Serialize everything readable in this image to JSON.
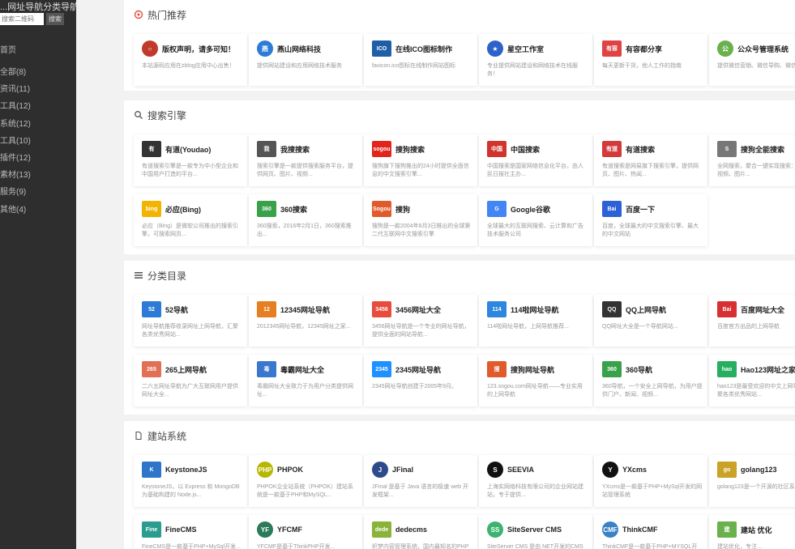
{
  "sidebar": {
    "title": "...网址导航分类导航",
    "search_placeholder": "搜索二维码",
    "search_button": "搜索",
    "home": "首页",
    "items": [
      "全部(8)",
      "资讯(11)",
      "工具(12)",
      "系统(12)",
      "工具(10)",
      "插件(12)",
      "素材(13)",
      "服务(9)",
      "其他(4)"
    ]
  },
  "sections": [
    {
      "title": "热门推荐",
      "icon": "fire-icon",
      "cards": [
        {
          "name": "版权声明，请多可知！",
          "desc": "本站源码应用在zblog应用中心出售！",
          "logo": "○",
          "color": "#c0392b",
          "wide": false
        },
        {
          "name": "燕山网络科技",
          "desc": "提供网站建设和应用网络技术服务",
          "logo": "燕",
          "color": "#2c7bd6",
          "wide": false
        },
        {
          "name": "在线ICO图标制作",
          "desc": "favicon.ico图标在线制作网站图标",
          "logo": "ICO",
          "color": "#1f5fa8",
          "wide": true
        },
        {
          "name": "星空工作室",
          "desc": "专业提供网站建设和网络技术在线服务！",
          "logo": "★",
          "color": "#2d63c8",
          "wide": false
        },
        {
          "name": "有容都分享",
          "desc": "每天更新干货，他人工作的指南",
          "logo": "有容",
          "color": "#e04343",
          "wide": true
        },
        {
          "name": "公众号管理系统",
          "desc": "提供微信营销、微信导购、微信...",
          "logo": "公",
          "color": "#6ab04c",
          "wide": false
        }
      ]
    },
    {
      "title": "搜索引擎",
      "icon": "search-icon",
      "cards": [
        {
          "name": "有道(Youdao)",
          "desc": "有道搜索引擎是一款专为中小型企业和中国用户打造的平台...",
          "logo": "有",
          "color": "#333333",
          "wide": true
        },
        {
          "name": "我搜搜索",
          "desc": "搜索引擎是一款提供搜索服务平台，提供网页、图片、视频...",
          "logo": "我",
          "color": "#555555",
          "wide": true
        },
        {
          "name": "搜狗搜索",
          "desc": "搜狗旗下搜狗推出的24小时提供全面信息的中文搜索引擎...",
          "logo": "sogou",
          "color": "#e1251b",
          "wide": true
        },
        {
          "name": "中国搜索",
          "desc": "中国搜索是国家网络信息化平台，由人民日报社主办...",
          "logo": "中国",
          "color": "#d0342c",
          "wide": true
        },
        {
          "name": "有道搜索",
          "desc": "有道搜索是网易旗下搜索引擎，提供网页、图片、热闻...",
          "logo": "有道",
          "color": "#d33a3a",
          "wide": true
        },
        {
          "name": "搜狗全能搜索",
          "desc": "全网搜索，聚合一键实现搜索：新闻、视频、图片...",
          "logo": "S",
          "color": "#777777",
          "wide": true
        },
        {
          "name": "必应(Bing)",
          "desc": "必应（Bing）是微软公司推出的搜索引擎，可搜索网页...",
          "logo": "bing",
          "color": "#f2b400",
          "wide": true
        },
        {
          "name": "360搜索",
          "desc": "360搜索，2016年2月1日，360搜索推出...",
          "logo": "360",
          "color": "#3aa14b",
          "wide": true
        },
        {
          "name": "搜狗",
          "desc": "搜狗是一款2004年8月3日推出的全球第二代互联网中文搜索引擎",
          "logo": "Sogou",
          "color": "#e05a2b",
          "wide": true
        },
        {
          "name": "Google谷歌",
          "desc": "全球最大的互联网搜索、云计算和广告技术服务公司",
          "logo": "G",
          "color": "#4285f4",
          "wide": true
        },
        {
          "name": "百度一下",
          "desc": "百度，全球最大的中文搜索引擎、最大的中文网站",
          "logo": "Bai",
          "color": "#2d62d6",
          "wide": true
        }
      ]
    },
    {
      "title": "分类目录",
      "icon": "list-icon",
      "cards": [
        {
          "name": "52导航",
          "desc": "网址导航推荐收录网址上网导航，汇聚各类优秀网站...",
          "logo": "52",
          "color": "#2d7bd6",
          "wide": true
        },
        {
          "name": "12345网址导航",
          "desc": "2012345网址导航，12345网址之家...",
          "logo": "12",
          "color": "#e67e22",
          "wide": true
        },
        {
          "name": "3456网址大全",
          "desc": "3456网址导航是一个专业的网址导航，提供全面的网站导航...",
          "logo": "3456",
          "color": "#e74c3c",
          "wide": true
        },
        {
          "name": "114啦网址导航",
          "desc": "114啦网址导航，上网导航推荐...",
          "logo": "114",
          "color": "#2e86de",
          "wide": true
        },
        {
          "name": "QQ上网导航",
          "desc": "QQ网址大全是一个导航网站...",
          "logo": "QQ",
          "color": "#333333",
          "wide": true
        },
        {
          "name": "百度网址大全",
          "desc": "百度官方出品的上网导航",
          "logo": "Bai",
          "color": "#d63031",
          "wide": true
        },
        {
          "name": "265上网导航",
          "desc": "二六五网址导航为广大互联网用户提供网址大全...",
          "logo": "265",
          "color": "#e17055",
          "wide": true
        },
        {
          "name": "毒霸网址大全",
          "desc": "毒霸网址大全致力于为用户分类提供网址...",
          "logo": "毒",
          "color": "#3a78d0",
          "wide": true
        },
        {
          "name": "2345网址导航",
          "desc": "2345网址导航创建于2005年9月。",
          "logo": "2345",
          "color": "#1e90ff",
          "wide": true
        },
        {
          "name": "搜狗网址导航",
          "desc": "123.sogou.com网址导航——专业实用的上网导航",
          "logo": "搜",
          "color": "#e05a2b",
          "wide": true
        },
        {
          "name": "360导航",
          "desc": "360导航，一个安全上网导航，为用户提供门户、新闻、视频...",
          "logo": "360",
          "color": "#3aa14b",
          "wide": true
        },
        {
          "name": "Hao123网址之家",
          "desc": "hao123是最受欢迎的中文上网导航，汇聚各类优秀网站...",
          "logo": "hao",
          "color": "#27ae60",
          "wide": true
        }
      ]
    },
    {
      "title": "建站系统",
      "icon": "document-icon",
      "cards": [
        {
          "name": "KeystoneJS",
          "desc": "KeystoneJS，以 Express 和 MongoDB 为基础构建的 Node.js...",
          "logo": "K",
          "color": "#2f75c9",
          "wide": true
        },
        {
          "name": "PHPOK",
          "desc": "PHPOK企业站系统（PHPOK）建站系统是一款基于PHP和MySQL...",
          "logo": "PHP",
          "color": "#b7b700",
          "wide": false
        },
        {
          "name": "JFinal",
          "desc": "JFinal 是基于 Java 语言的极速 web 开发框架...",
          "logo": "J",
          "color": "#2d4a8a",
          "wide": false
        },
        {
          "name": "SEEVIA",
          "desc": "上海实网络科技有限公司的企业网站建站，专于提供...",
          "logo": "S",
          "color": "#111111",
          "wide": false
        },
        {
          "name": "YXcms",
          "desc": "YXcms是一款基于PHP+MySql开发的网站管理系统",
          "logo": "Y",
          "color": "#111111",
          "wide": false
        },
        {
          "name": "golang123",
          "desc": "golang123是一个开源的社区系统...",
          "logo": "go",
          "color": "#c9a227",
          "wide": true
        },
        {
          "name": "FineCMS",
          "desc": "FineCMS是一款基于PHP+MySql开发...",
          "logo": "Fine",
          "color": "#2a9d8f",
          "wide": true
        },
        {
          "name": "YFCMF",
          "desc": "YFCMF是基于ThinkPHP开发...",
          "logo": "YF",
          "color": "#2b7a5b",
          "wide": false
        },
        {
          "name": "dedecms",
          "desc": "织梦内容管理系统，国内最知名的PHP开源网站管理系统...",
          "logo": "dede",
          "color": "#8ab33a",
          "wide": true
        },
        {
          "name": "SiteServer CMS",
          "desc": "SiteServer CMS 是由.NET开发的CMS系统",
          "logo": "SS",
          "color": "#3cb371",
          "wide": false
        },
        {
          "name": "ThinkCMF",
          "desc": "ThinkCMF是一款基于PHP+MYSQL开发...",
          "logo": "CMF",
          "color": "#3b82c4",
          "wide": false
        },
        {
          "name": "建站 优化",
          "desc": "建站优化，专注...",
          "logo": "建",
          "color": "#6ab04c",
          "wide": true
        }
      ]
    }
  ]
}
